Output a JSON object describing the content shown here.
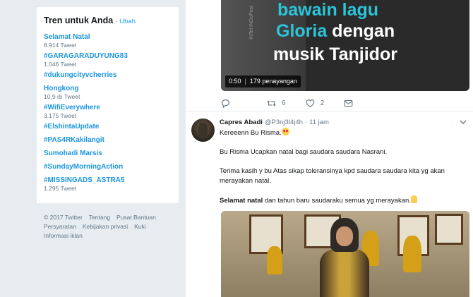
{
  "trends": {
    "title": "Tren untuk Anda",
    "separator": "·",
    "change": "Ubah",
    "items": [
      {
        "name": "Selamat Natal",
        "count": "8.914 Tweet"
      },
      {
        "name": "#GARAGARADUYUNG83",
        "count": "1.046 Tweet"
      },
      {
        "name": "#dukungcityvcherries",
        "count": ""
      },
      {
        "name": "Hongkong",
        "count": "10,9 rb Tweet"
      },
      {
        "name": "#WifiEverywhere",
        "count": "3.175 Tweet"
      },
      {
        "name": "#ElshintaUpdate",
        "count": ""
      },
      {
        "name": "#PAS4RKakilangit",
        "count": ""
      },
      {
        "name": "Sumohadi Marsis",
        "count": ""
      },
      {
        "name": "#SundayMorningAction",
        "count": ""
      },
      {
        "name": "#MISSINGADS_ASTRA5",
        "count": "1.295 Tweet"
      }
    ]
  },
  "footer": {
    "copyright": "© 2017 Twitter",
    "about": "Tentang",
    "help": "Pusat Bantuan",
    "terms": "Persyaratan",
    "privacy": "Kebijakan privasi",
    "cookies": "Kuki",
    "ads": "Informasi iklan"
  },
  "video": {
    "line1": "bawain lagu",
    "line2a": "Gloria",
    "line2b": " dengan",
    "line3": "musik Tanjidor",
    "side_text": "INTel INDoPost",
    "duration": "0:50",
    "views": "179 penayangan"
  },
  "actions": {
    "reply_count": "",
    "retweet_count": "6",
    "like_count": "2"
  },
  "tweet": {
    "name": "Capres Abadi",
    "handle": "@P3nj3l4j4h",
    "dot": "·",
    "time": "11 jam",
    "line1": "Kereeenn Bu Risma.",
    "line2": "Bu Risma Ucapkan natal bagi saudara saudara Nasrani.",
    "line3": "Terima kasih y bu Atas sikap toleransinya kpd saudara saudara kita yg akan merayakan natal.",
    "line4_bold": "Selamat natal",
    "line4_rest": " dan tahun baru saudaraku semua yg merayakan."
  },
  "colors": {
    "link": "#1b95e0",
    "accent": "#1da1f2",
    "muted": "#657786",
    "background": "#e6ecf0"
  },
  "icons": [
    "reply-icon",
    "retweet-icon",
    "like-icon",
    "dm-icon",
    "caret-down-icon",
    "heart-eyes-emoji",
    "praying-hands-emoji"
  ]
}
